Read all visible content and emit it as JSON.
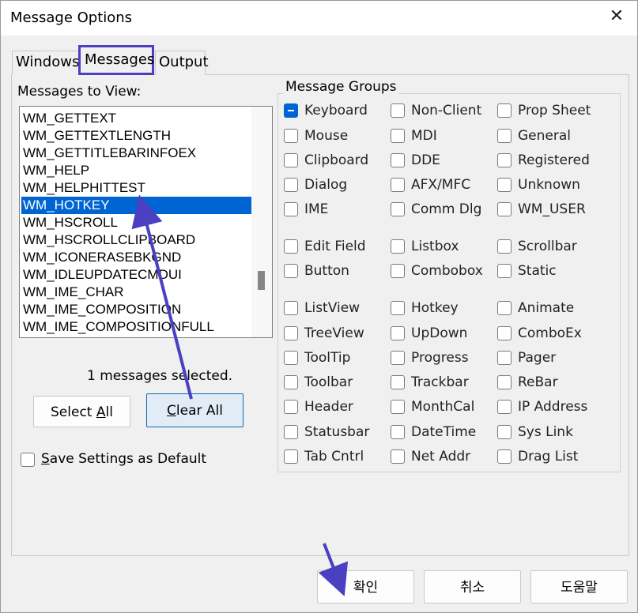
{
  "window": {
    "title": "Message Options",
    "close_glyph": "✕"
  },
  "tabs": [
    {
      "label": "Windows"
    },
    {
      "label": "Messages"
    },
    {
      "label": "Output"
    }
  ],
  "messages": {
    "label": "Messages to View:",
    "items": [
      "WM_GETTEXT",
      "WM_GETTEXTLENGTH",
      "WM_GETTITLEBARINFOEX",
      "WM_HELP",
      "WM_HELPHITTEST",
      "WM_HOTKEY",
      "WM_HSCROLL",
      "WM_HSCROLLCLIPBOARD",
      "WM_ICONERASEBKGND",
      "WM_IDLEUPDATECMDUI",
      "WM_IME_CHAR",
      "WM_IME_COMPOSITION",
      "WM_IME_COMPOSITIONFULL"
    ],
    "selected_item": "WM_HOTKEY",
    "selected_count_text": "1 messages selected.",
    "select_all_label": "Select All",
    "clear_all_label": "Clear All",
    "save_default_label": "Save Settings as Default"
  },
  "groups": {
    "title": "Message Groups",
    "col1": [
      "Keyboard",
      "Mouse",
      "Clipboard",
      "Dialog",
      "IME",
      "Edit Field",
      "Button",
      "ListView",
      "TreeView",
      "ToolTip",
      "Toolbar",
      "Header",
      "Statusbar",
      "Tab Cntrl"
    ],
    "col2": [
      "Non-Client",
      "MDI",
      "DDE",
      "AFX/MFC",
      "Comm Dlg",
      "Listbox",
      "Combobox",
      "Hotkey",
      "UpDown",
      "Progress",
      "Trackbar",
      "MonthCal",
      "DateTime",
      "Net Addr"
    ],
    "col3": [
      "Prop Sheet",
      "General",
      "Registered",
      "Unknown",
      "WM_USER",
      "Scrollbar",
      "Static",
      "Animate",
      "ComboEx",
      "Pager",
      "ReBar",
      "IP Address",
      "Sys Link",
      "Drag List"
    ],
    "indeterminate": "Keyboard"
  },
  "footer": {
    "ok_label": "확인",
    "cancel_label": "취소",
    "help_label": "도움말"
  },
  "colors": {
    "accent": "#0064d2",
    "annotation": "#4b3fc2"
  }
}
